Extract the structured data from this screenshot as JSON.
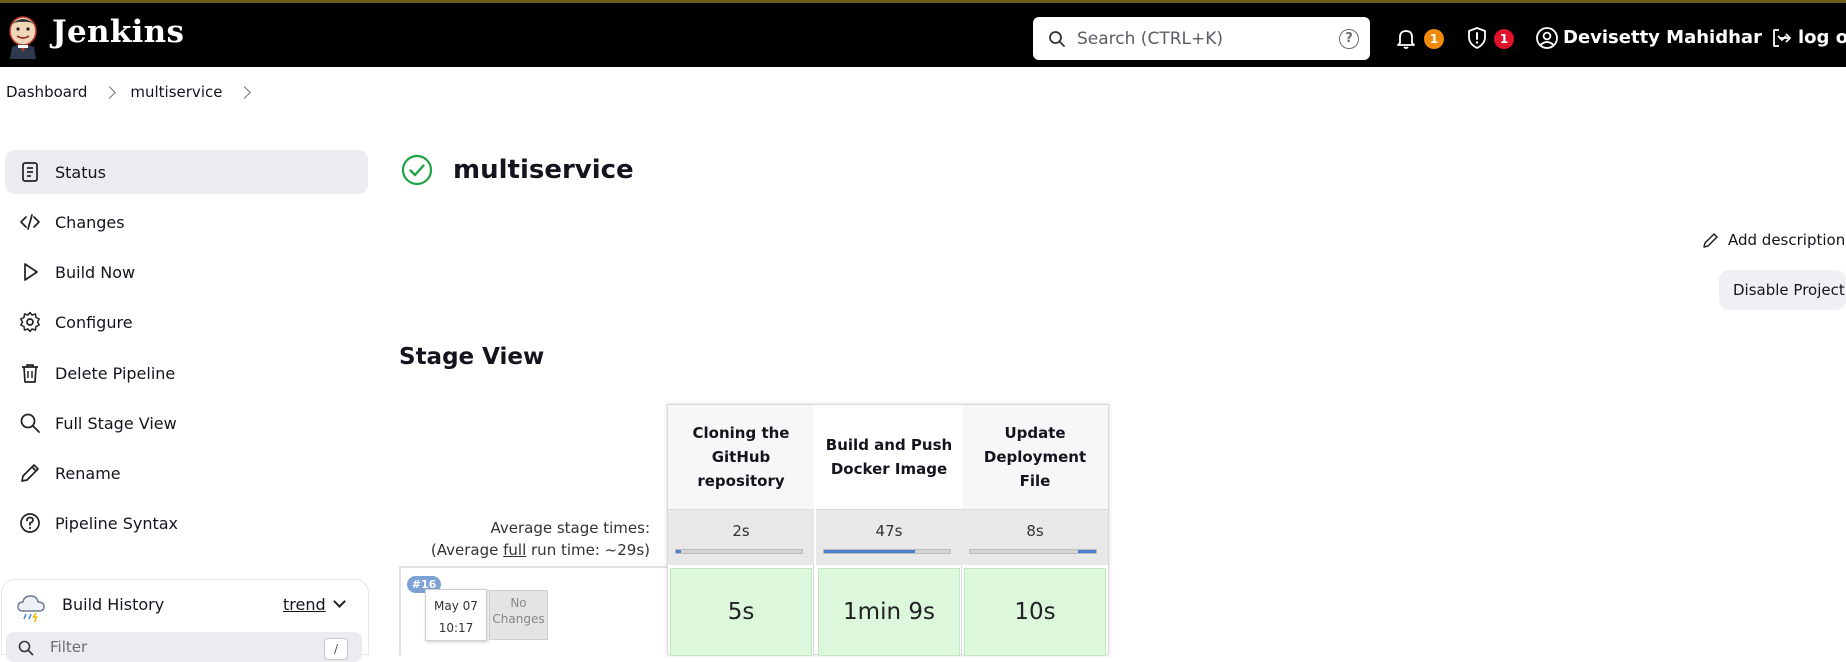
{
  "header": {
    "brand": "Jenkins",
    "search_placeholder": "Search (CTRL+K)",
    "help_glyph": "?",
    "notifications_count": "1",
    "security_count": "1",
    "user_name": "Devisetty Mahidhar",
    "logout_label": "log ou",
    "colors": {
      "bar": "#000000",
      "notification_badge": "#f08a0a",
      "security_badge": "#e0112b"
    }
  },
  "breadcrumb": {
    "items": [
      "Dashboard",
      "multiservice"
    ]
  },
  "sidebar": {
    "items": [
      {
        "label": "Status",
        "icon": "document-icon"
      },
      {
        "label": "Changes",
        "icon": "code-icon"
      },
      {
        "label": "Build Now",
        "icon": "play-icon"
      },
      {
        "label": "Configure",
        "icon": "gear-icon"
      },
      {
        "label": "Delete Pipeline",
        "icon": "trash-icon"
      },
      {
        "label": "Full Stage View",
        "icon": "search-icon"
      },
      {
        "label": "Rename",
        "icon": "pencil-icon"
      },
      {
        "label": "Pipeline Syntax",
        "icon": "help-circle-icon"
      }
    ],
    "build_history": {
      "title": "Build History",
      "trend_label": "trend",
      "filter_placeholder": "Filter",
      "filter_shortcut": "/"
    }
  },
  "main": {
    "title": "multiservice",
    "add_description_label": "Add description",
    "disable_project_label": "Disable Project",
    "stage_view_heading": "Stage View",
    "average_stage_times_label": "Average stage times:",
    "average_full_prefix": "(Average ",
    "average_full_link": "full",
    "average_full_suffix": " run time: ~29s)",
    "stages": [
      {
        "name": "Cloning the GitHub repository",
        "avg": "2s",
        "avg_fraction": 0.04,
        "result": "5s"
      },
      {
        "name": "Build and Push Docker Image",
        "avg": "47s",
        "avg_fraction": 0.72,
        "result": "1min 9s"
      },
      {
        "name": "Update Deployment File",
        "avg": "8s",
        "avg_fraction": 0.14,
        "result": "10s"
      }
    ],
    "build": {
      "number": "#16",
      "date": "May 07",
      "time": "10:17",
      "changes": "No Changes"
    }
  }
}
